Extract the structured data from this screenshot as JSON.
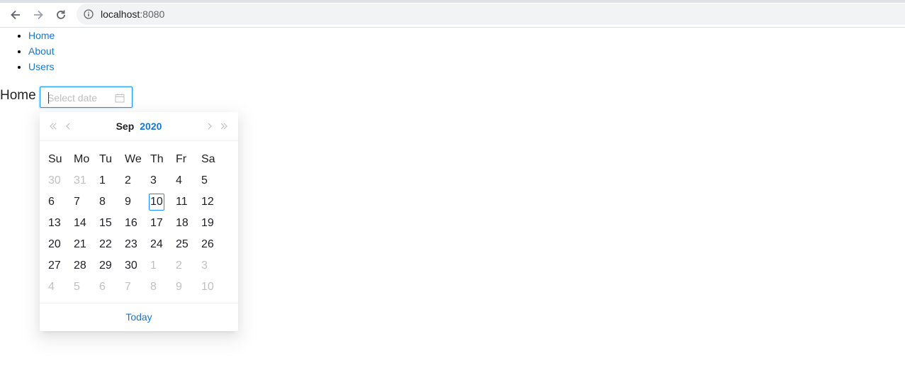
{
  "browser": {
    "url_host": "localhost",
    "url_port": ":8080"
  },
  "nav": {
    "items": [
      {
        "label": "Home"
      },
      {
        "label": "About"
      },
      {
        "label": "Users"
      }
    ]
  },
  "page": {
    "heading": "Home"
  },
  "datepicker": {
    "placeholder": "Select date",
    "month": "Sep",
    "year": "2020",
    "weekdays": [
      "Su",
      "Mo",
      "Tu",
      "We",
      "Th",
      "Fr",
      "Sa"
    ],
    "weeks": [
      [
        {
          "d": "30",
          "out": true
        },
        {
          "d": "31",
          "out": true
        },
        {
          "d": "1"
        },
        {
          "d": "2"
        },
        {
          "d": "3"
        },
        {
          "d": "4"
        },
        {
          "d": "5"
        }
      ],
      [
        {
          "d": "6"
        },
        {
          "d": "7"
        },
        {
          "d": "8"
        },
        {
          "d": "9"
        },
        {
          "d": "10",
          "today": true
        },
        {
          "d": "11"
        },
        {
          "d": "12"
        }
      ],
      [
        {
          "d": "13"
        },
        {
          "d": "14"
        },
        {
          "d": "15"
        },
        {
          "d": "16"
        },
        {
          "d": "17"
        },
        {
          "d": "18"
        },
        {
          "d": "19"
        }
      ],
      [
        {
          "d": "20"
        },
        {
          "d": "21"
        },
        {
          "d": "22"
        },
        {
          "d": "23"
        },
        {
          "d": "24"
        },
        {
          "d": "25"
        },
        {
          "d": "26"
        }
      ],
      [
        {
          "d": "27"
        },
        {
          "d": "28"
        },
        {
          "d": "29"
        },
        {
          "d": "30"
        },
        {
          "d": "1",
          "out": true
        },
        {
          "d": "2",
          "out": true
        },
        {
          "d": "3",
          "out": true
        }
      ],
      [
        {
          "d": "4",
          "out": true
        },
        {
          "d": "5",
          "out": true
        },
        {
          "d": "6",
          "out": true
        },
        {
          "d": "7",
          "out": true
        },
        {
          "d": "8",
          "out": true
        },
        {
          "d": "9",
          "out": true
        },
        {
          "d": "10",
          "out": true
        }
      ]
    ],
    "footer_label": "Today"
  },
  "icons": {
    "back": "arrow-left-icon",
    "forward": "arrow-right-icon",
    "reload": "reload-icon",
    "info": "info-icon",
    "calendar": "calendar-icon",
    "super_prev": "double-chevron-left-icon",
    "prev": "chevron-left-icon",
    "next": "chevron-right-icon",
    "super_next": "double-chevron-right-icon"
  },
  "colors": {
    "link": "#1677d2",
    "focus_border": "#1890ff",
    "muted_day": "#c0c0c0"
  }
}
